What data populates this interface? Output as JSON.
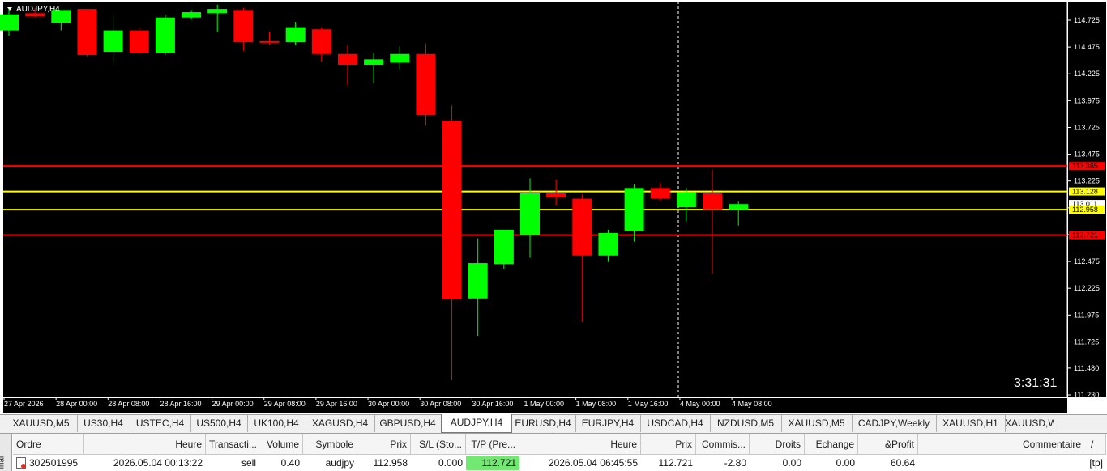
{
  "chart": {
    "title": "AUDJPY,H4",
    "timer": "3:31:31",
    "colors": {
      "bg": "#000000",
      "bull": "#00ff00",
      "bear": "#ff0000",
      "grid_text": "#ffffff",
      "red_line": "#ff0000",
      "yellow_line": "#ffff00"
    },
    "price_labels": [
      "114.725",
      "114.475",
      "114.225",
      "113.975",
      "113.725",
      "113.475",
      "113.225",
      "112.975",
      "112.725",
      "112.475",
      "112.225",
      "111.975",
      "111.725",
      "111.480",
      "111.230"
    ],
    "time_labels": [
      "27 Apr 2026",
      "28 Apr 00:00",
      "28 Apr 08:00",
      "28 Apr 16:00",
      "29 Apr 00:00",
      "29 Apr 08:00",
      "29 Apr 16:00",
      "30 Apr 00:00",
      "30 Apr 08:00",
      "30 Apr 16:00",
      "1 May 00:00",
      "1 May 08:00",
      "1 May 16:00",
      "4 May 00:00",
      "4 May 08:00"
    ],
    "level_tags": [
      {
        "value": "113.365",
        "color": "#ff0000",
        "text_color": "#000000"
      },
      {
        "value": "113.128",
        "color": "#ffff00",
        "text_color": "#000000"
      },
      {
        "value": "113.011",
        "color": "#ffffff",
        "text_color": "#000000"
      },
      {
        "value": "112.958",
        "color": "#ffff00",
        "text_color": "#000000"
      },
      {
        "value": "112.721",
        "color": "#ff0000",
        "text_color": "#000000"
      }
    ],
    "hlines": [
      {
        "price": 113.365,
        "color": "#ff0000"
      },
      {
        "price": 113.128,
        "color": "#ffff00"
      },
      {
        "price": 112.958,
        "color": "#ffff00"
      },
      {
        "price": 112.721,
        "color": "#ff0000"
      }
    ],
    "candles": [
      {
        "o": 114.63,
        "h": 114.83,
        "l": 114.58,
        "c": 114.78
      },
      {
        "o": 114.79,
        "h": 114.84,
        "l": 114.75,
        "c": 114.76
      },
      {
        "o": 114.7,
        "h": 114.8,
        "l": 114.63,
        "c": 114.82
      },
      {
        "o": 114.83,
        "h": 114.83,
        "l": 114.39,
        "c": 114.4
      },
      {
        "o": 114.43,
        "h": 114.76,
        "l": 114.33,
        "c": 114.63
      },
      {
        "o": 114.63,
        "h": 114.66,
        "l": 114.4,
        "c": 114.42
      },
      {
        "o": 114.42,
        "h": 114.78,
        "l": 114.4,
        "c": 114.75
      },
      {
        "o": 114.75,
        "h": 114.82,
        "l": 114.73,
        "c": 114.8
      },
      {
        "o": 114.79,
        "h": 114.87,
        "l": 114.62,
        "c": 114.83
      },
      {
        "o": 114.82,
        "h": 114.84,
        "l": 114.44,
        "c": 114.52
      },
      {
        "o": 114.53,
        "h": 114.62,
        "l": 114.5,
        "c": 114.52
      },
      {
        "o": 114.52,
        "h": 114.71,
        "l": 114.49,
        "c": 114.66
      },
      {
        "o": 114.64,
        "h": 114.66,
        "l": 114.34,
        "c": 114.41
      },
      {
        "o": 114.41,
        "h": 114.49,
        "l": 114.12,
        "c": 114.31
      },
      {
        "o": 114.31,
        "h": 114.42,
        "l": 114.14,
        "c": 114.36
      },
      {
        "o": 114.33,
        "h": 114.48,
        "l": 114.27,
        "c": 114.41
      },
      {
        "o": 114.41,
        "h": 114.51,
        "l": 113.74,
        "c": 113.84
      },
      {
        "o": 113.79,
        "h": 113.93,
        "l": 111.37,
        "c": 112.12
      },
      {
        "o": 112.13,
        "h": 112.69,
        "l": 111.78,
        "c": 112.46
      },
      {
        "o": 112.45,
        "h": 112.74,
        "l": 112.4,
        "c": 112.77
      },
      {
        "o": 112.72,
        "h": 113.25,
        "l": 112.51,
        "c": 113.11
      },
      {
        "o": 113.11,
        "h": 113.24,
        "l": 113.0,
        "c": 113.07
      },
      {
        "o": 113.06,
        "h": 113.1,
        "l": 111.91,
        "c": 112.53
      },
      {
        "o": 112.53,
        "h": 112.77,
        "l": 112.47,
        "c": 112.74
      },
      {
        "o": 112.76,
        "h": 113.2,
        "l": 112.66,
        "c": 113.16
      },
      {
        "o": 113.16,
        "h": 113.21,
        "l": 113.04,
        "c": 113.06
      },
      {
        "o": 112.98,
        "h": 113.16,
        "l": 112.85,
        "c": 113.12
      },
      {
        "o": 113.11,
        "h": 113.33,
        "l": 112.36,
        "c": 112.96
      },
      {
        "o": 112.96,
        "h": 113.04,
        "l": 112.81,
        "c": 113.01
      }
    ]
  },
  "tabs": [
    "XAUUSD,M5",
    "US30,H4",
    "USTEC,H4",
    "US500,H4",
    "UK100,H4",
    "XAGUSD,H4",
    "GBPUSD,H4",
    "AUDJPY,H4",
    "EURUSD,H4",
    "EURJPY,H4",
    "USDCAD,H4",
    "NZDUSD,M5",
    "XAUUSD,M5",
    "CADJPY,Weekly",
    "XAUUSD,H1",
    "XAUUSD,Wee"
  ],
  "active_tab": "AUDJPY,H4",
  "terminal": {
    "side_label": "inal",
    "headers": [
      "Ordre",
      "Heure",
      "Transacti...",
      "Volume",
      "Symbole",
      "Prix",
      "S/L (Sto...",
      "T/P (Pre...",
      "Heure",
      "Prix",
      "Commis...",
      "Droits",
      "Echange",
      "&Profit",
      "Commentaire"
    ],
    "row": [
      "302501995",
      "2026.05.04 00:13:22",
      "sell",
      "0.40",
      "audjpy",
      "112.958",
      "0.000",
      "112.721",
      "2026.05.04 06:45:55",
      "112.721",
      "-2.80",
      "0.00",
      "0.00",
      "60.64",
      "[tp]"
    ],
    "sort_indicator": "/"
  }
}
